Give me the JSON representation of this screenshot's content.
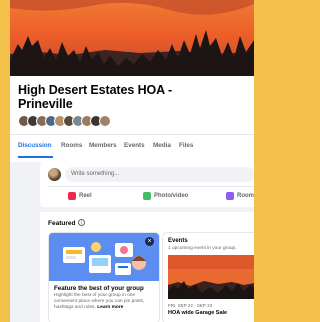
{
  "group": {
    "title_line1": "High Desert Estates HOA -",
    "title_line2": "Prineville"
  },
  "tabs": [
    {
      "label": "Discussion",
      "active": true
    },
    {
      "label": "Rooms"
    },
    {
      "label": "Members"
    },
    {
      "label": "Events"
    },
    {
      "label": "Media"
    },
    {
      "label": "Files"
    }
  ],
  "composer": {
    "placeholder": "Write something...",
    "actions": [
      {
        "label": "Reel",
        "icon": "reel-icon",
        "color": "#f02849"
      },
      {
        "label": "Photo/video",
        "icon": "photo-video-icon",
        "color": "#45bd62"
      },
      {
        "label": "Room",
        "icon": "room-icon",
        "color": "#8b5cf6"
      }
    ]
  },
  "featured": {
    "heading": "Featured",
    "info_glyph": "i",
    "close_glyph": "×",
    "card_title": "Feature the best of your group",
    "card_desc": "Highlight the best of your group in one convenient place where you can pin posts, hashtags and rules.",
    "card_link": "Learn more"
  },
  "events": {
    "title": "Events",
    "subtitle": "1 upcoming event in your group.",
    "date": "FRI, SEP 22 - SEP 23",
    "name": "HOA wide Garage Sale"
  },
  "colors": {
    "accent": "#1b74e4",
    "page_border": "#f3c04a"
  }
}
